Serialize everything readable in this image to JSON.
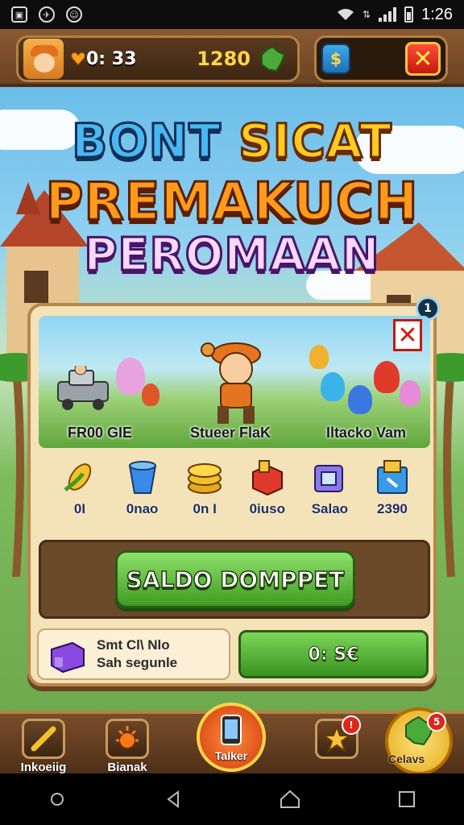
{
  "status_bar": {
    "time": "1:26"
  },
  "hud": {
    "lives": "0: 33",
    "coins": "1280"
  },
  "title": {
    "line1a": "BONT",
    "line1b": "SICAT",
    "line2": "PREMAKUCH",
    "line3": "PEROMAAN"
  },
  "panel": {
    "badge": "1",
    "banner_labels": [
      "FR00 GIE",
      "Stueer FlaK",
      "Iltacko Vam"
    ],
    "items": [
      {
        "label": "0I",
        "icon": "corn-icon"
      },
      {
        "label": "0nao",
        "icon": "bucket-icon"
      },
      {
        "label": "0n I",
        "icon": "coin-stack-icon"
      },
      {
        "label": "0iuso",
        "icon": "red-box-icon"
      },
      {
        "label": "Salao",
        "icon": "purple-crate-icon"
      },
      {
        "label": "2390",
        "icon": "blue-crate-icon"
      }
    ],
    "main_button": "SALDO DOMPPET",
    "info_line1": "Smt Cl\\ Nlo",
    "info_line2": "Sah segunle",
    "small_button": "0: S€"
  },
  "bottom_nav": {
    "items": [
      {
        "label": "Inkoeiig"
      },
      {
        "label": "Bianak"
      },
      {
        "label": "Talker"
      },
      {
        "label": "Celavs"
      }
    ],
    "badge_a": "!",
    "badge_b": "5"
  },
  "colors": {
    "accent_green": "#3f9b22",
    "accent_red": "#c2190c",
    "panel_bg": "#f4e2b8",
    "wood": "#6b4221"
  }
}
